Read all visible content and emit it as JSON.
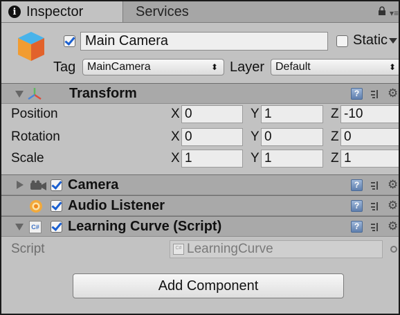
{
  "tabs": [
    {
      "label": "Inspector",
      "icon": "info-icon",
      "active": true
    },
    {
      "label": "Services",
      "active": false
    }
  ],
  "header": {
    "object_name": "Main Camera",
    "active_checked": true,
    "static_label": "Static",
    "static_checked": false,
    "tag_label": "Tag",
    "tag_value": "MainCamera",
    "layer_label": "Layer",
    "layer_value": "Default"
  },
  "transform": {
    "title": "Transform",
    "rows": [
      {
        "label": "Position",
        "x": "0",
        "y": "1",
        "z": "-10"
      },
      {
        "label": "Rotation",
        "x": "0",
        "y": "0",
        "z": "0"
      },
      {
        "label": "Scale",
        "x": "1",
        "y": "1",
        "z": "1"
      }
    ],
    "axis_x": "X",
    "axis_y": "Y",
    "axis_z": "Z"
  },
  "components": [
    {
      "title": "Camera",
      "icon": "camera-icon",
      "enabled": true,
      "expanded": false
    },
    {
      "title": "Audio Listener",
      "icon": "audio-listener-icon",
      "enabled": true,
      "expanded": false
    },
    {
      "title": "Learning Curve (Script)",
      "icon": "csharp-script-icon",
      "enabled": true,
      "expanded": true
    }
  ],
  "script": {
    "label": "Script",
    "value": "LearningCurve",
    "icon_text": "C#"
  },
  "add_component_label": "Add Component",
  "colors": {
    "panel_bg": "#c2c2c2",
    "header_bg": "#a9a9a9",
    "checkmark": "#1a5fd0"
  }
}
